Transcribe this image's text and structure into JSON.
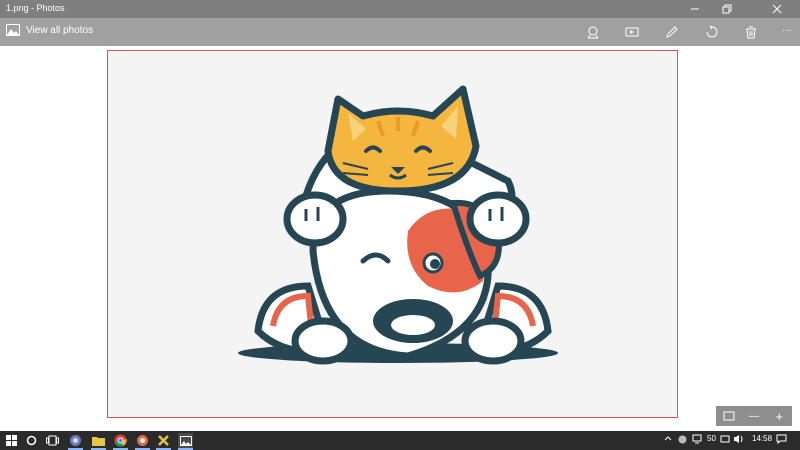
{
  "window": {
    "title": "1.png - Photos"
  },
  "toolbar": {
    "back_label": "View all photos",
    "tools": [
      {
        "icon": "share-icon"
      },
      {
        "icon": "slideshow-icon"
      },
      {
        "icon": "edit-icon"
      },
      {
        "icon": "rotate-icon"
      },
      {
        "icon": "delete-icon"
      },
      {
        "icon": "more-icon"
      }
    ],
    "more_label": "···"
  },
  "zoom": {
    "minus_label": "—",
    "plus_label": "+"
  },
  "taskbar": {
    "volume_text": "50",
    "time": "14:58"
  },
  "colors": {
    "cat_orange": "#f4b63e",
    "dog_patch": "#e8654c",
    "outline": "#264653",
    "photo_border": "#d9534f"
  }
}
